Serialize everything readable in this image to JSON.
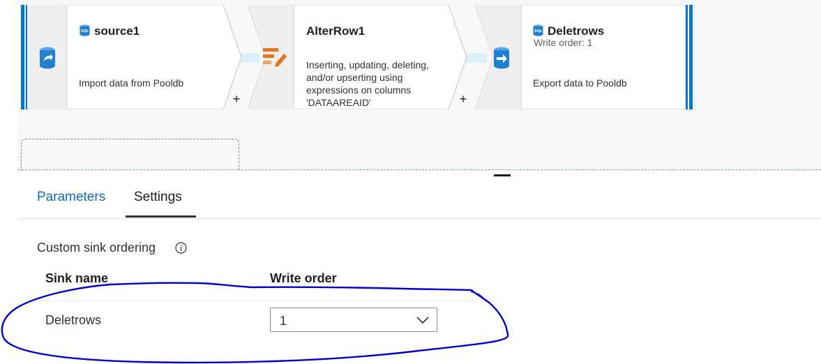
{
  "flow": {
    "source": {
      "title": "source1",
      "description": "Import data from Pooldb"
    },
    "alter_row": {
      "title": "AlterRow1",
      "description": "Inserting, updating, deleting, and/or upserting using expressions on columns 'DATAAREAID'"
    },
    "sink": {
      "title": "Deletrows",
      "write_order": "Write order: 1",
      "description": "Export data to Pooldb"
    },
    "add_symbol": "+"
  },
  "tabs": [
    {
      "label": "Parameters",
      "active": false
    },
    {
      "label": "Settings",
      "active": true
    }
  ],
  "settings": {
    "section_title": "Custom sink ordering",
    "columns": {
      "sink_name": "Sink name",
      "write_order": "Write order"
    },
    "rows": [
      {
        "sink_name": "Deletrows",
        "write_order": "1"
      }
    ]
  },
  "colors": {
    "accent_blue": "#0078d4",
    "tab_link": "#0f6cbd",
    "alter_row_orange": "#e8741e",
    "annotation_ink": "#0000cc"
  },
  "icons": {
    "source": "database-import-icon",
    "alter_row": "alter-row-icon",
    "sink": "database-export-icon",
    "info": "info-icon",
    "chevron": "chevron-down-icon"
  }
}
